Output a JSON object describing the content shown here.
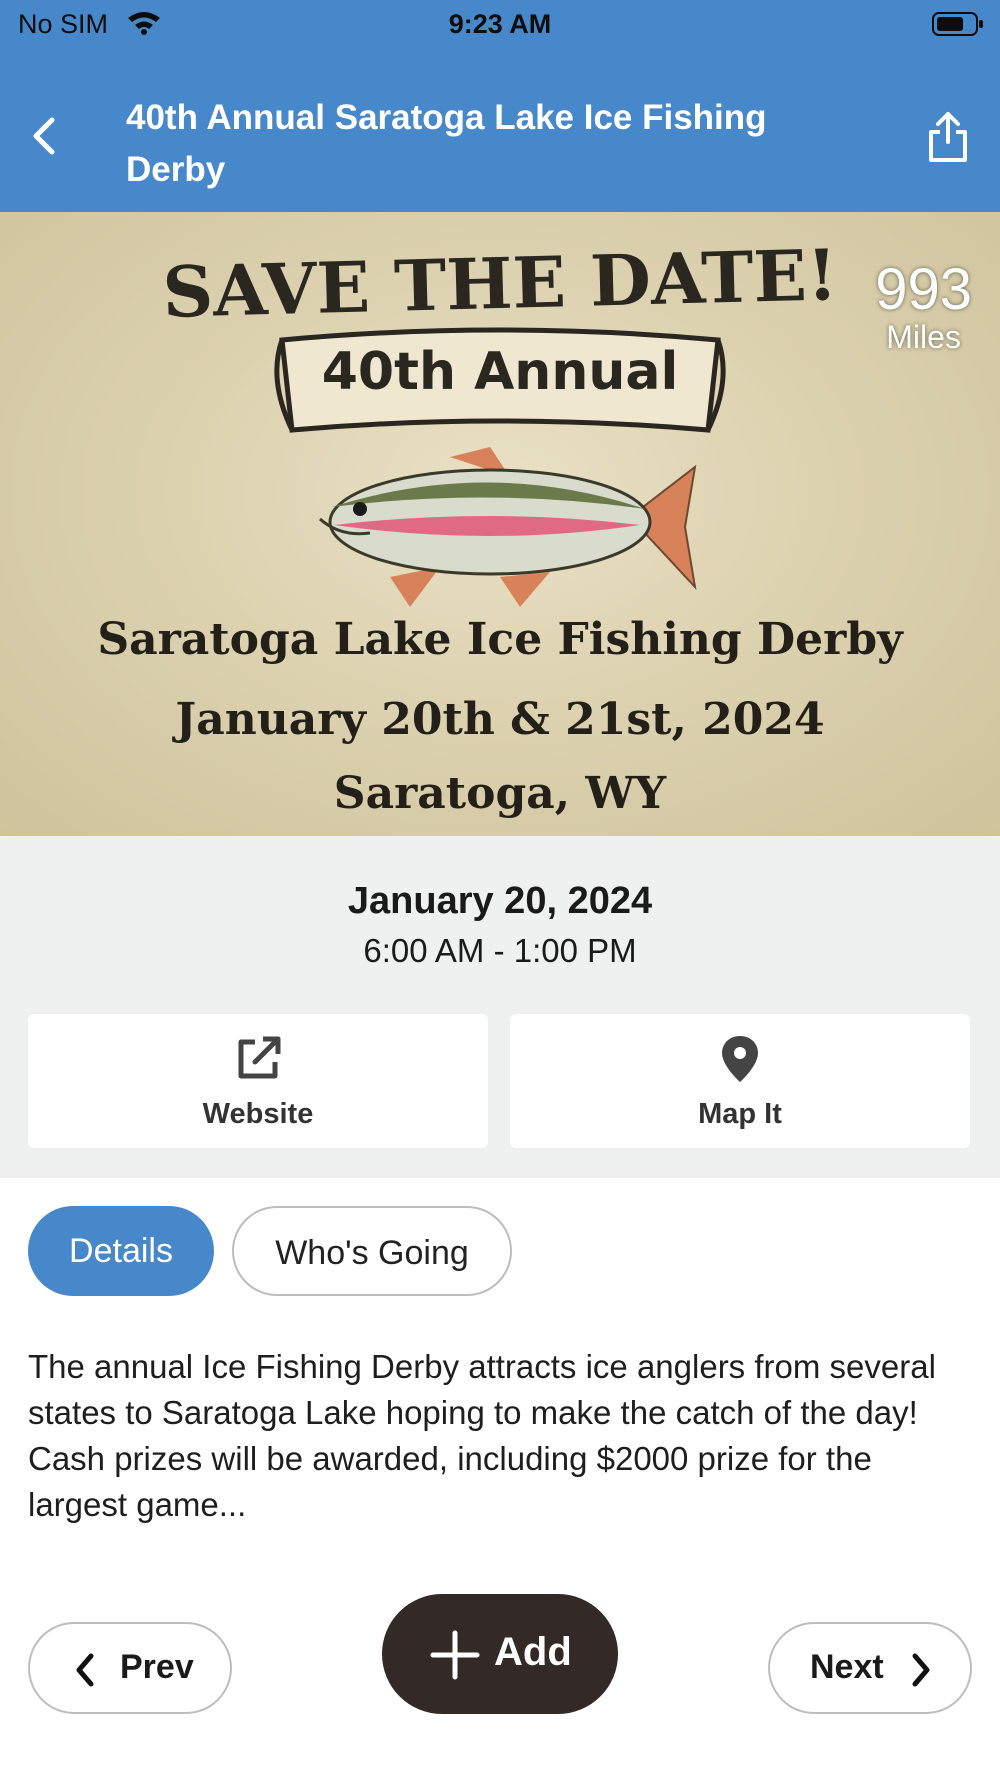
{
  "status_bar": {
    "carrier": "No SIM",
    "time": "9:23 AM"
  },
  "nav": {
    "title": "40th Annual Saratoga Lake Ice Fishing Derby"
  },
  "hero": {
    "headline": "SAVE THE DATE!",
    "banner": "40th Annual",
    "line1": "Saratoga Lake Ice Fishing Derby",
    "line2": "January 20th & 21st, 2024",
    "line3": "Saratoga, WY",
    "distance_value": "993",
    "distance_unit": "Miles"
  },
  "event": {
    "date": "January 20, 2024",
    "time": "6:00 AM - 1:00 PM"
  },
  "actions": {
    "website_label": "Website",
    "map_label": "Map It"
  },
  "tabs": {
    "details": "Details",
    "whos_going": "Who's Going"
  },
  "description": "The annual Ice Fishing Derby attracts ice anglers from several states to Saratoga Lake hoping to make the catch of the day! Cash prizes will be awarded, including $2000 prize for the largest game...",
  "pager": {
    "prev": "Prev",
    "add": "Add",
    "next": "Next"
  },
  "colors": {
    "accent": "#4788cb",
    "add_button": "#332a27",
    "panel": "#eff0f0"
  }
}
